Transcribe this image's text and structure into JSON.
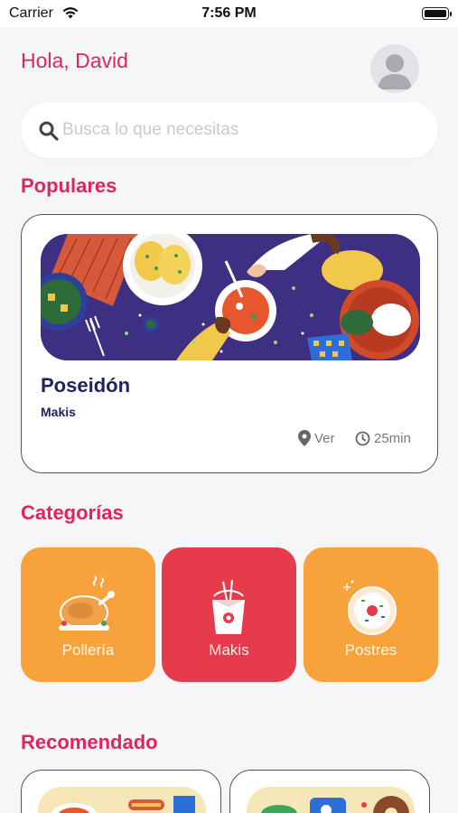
{
  "status_bar": {
    "carrier": "Carrier",
    "time": "7:56 PM"
  },
  "header": {
    "greeting": "Hola, David"
  },
  "search": {
    "placeholder": "Busca lo que necesitas",
    "icon": "search-icon"
  },
  "sections": {
    "popular": "Populares",
    "categories": "Categorías",
    "recommended": "Recomendado"
  },
  "popular": {
    "name": "Poseidón",
    "category": "Makis",
    "location_label": "Ver",
    "time_label": "25min"
  },
  "categories": [
    {
      "label": "Pollería",
      "color": "#f7a23b",
      "icon": "roast-chicken-icon"
    },
    {
      "label": "Makis",
      "color": "#e53b4c",
      "icon": "noodle-box-icon"
    },
    {
      "label": "Postres",
      "color": "#f7a23b",
      "icon": "donut-icon"
    }
  ],
  "colors": {
    "accent": "#e0245e",
    "navy": "#1f2360",
    "background": "#f6f6f8"
  }
}
